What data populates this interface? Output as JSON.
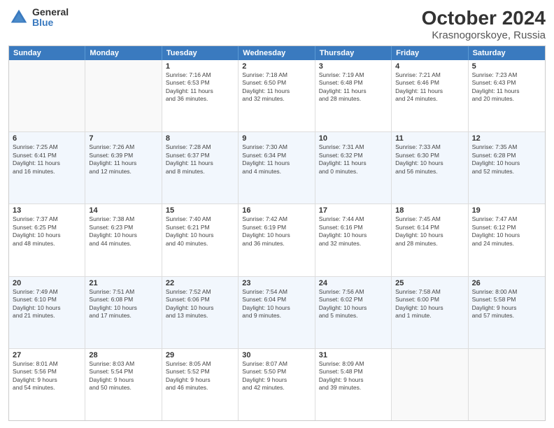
{
  "header": {
    "logo": {
      "general": "General",
      "blue": "Blue"
    },
    "title": "October 2024",
    "subtitle": "Krasnogorskoye, Russia"
  },
  "calendar": {
    "days": [
      "Sunday",
      "Monday",
      "Tuesday",
      "Wednesday",
      "Thursday",
      "Friday",
      "Saturday"
    ],
    "weeks": [
      [
        {
          "day": "",
          "info": ""
        },
        {
          "day": "",
          "info": ""
        },
        {
          "day": "1",
          "info": "Sunrise: 7:16 AM\nSunset: 6:53 PM\nDaylight: 11 hours\nand 36 minutes."
        },
        {
          "day": "2",
          "info": "Sunrise: 7:18 AM\nSunset: 6:50 PM\nDaylight: 11 hours\nand 32 minutes."
        },
        {
          "day": "3",
          "info": "Sunrise: 7:19 AM\nSunset: 6:48 PM\nDaylight: 11 hours\nand 28 minutes."
        },
        {
          "day": "4",
          "info": "Sunrise: 7:21 AM\nSunset: 6:46 PM\nDaylight: 11 hours\nand 24 minutes."
        },
        {
          "day": "5",
          "info": "Sunrise: 7:23 AM\nSunset: 6:43 PM\nDaylight: 11 hours\nand 20 minutes."
        }
      ],
      [
        {
          "day": "6",
          "info": "Sunrise: 7:25 AM\nSunset: 6:41 PM\nDaylight: 11 hours\nand 16 minutes."
        },
        {
          "day": "7",
          "info": "Sunrise: 7:26 AM\nSunset: 6:39 PM\nDaylight: 11 hours\nand 12 minutes."
        },
        {
          "day": "8",
          "info": "Sunrise: 7:28 AM\nSunset: 6:37 PM\nDaylight: 11 hours\nand 8 minutes."
        },
        {
          "day": "9",
          "info": "Sunrise: 7:30 AM\nSunset: 6:34 PM\nDaylight: 11 hours\nand 4 minutes."
        },
        {
          "day": "10",
          "info": "Sunrise: 7:31 AM\nSunset: 6:32 PM\nDaylight: 11 hours\nand 0 minutes."
        },
        {
          "day": "11",
          "info": "Sunrise: 7:33 AM\nSunset: 6:30 PM\nDaylight: 10 hours\nand 56 minutes."
        },
        {
          "day": "12",
          "info": "Sunrise: 7:35 AM\nSunset: 6:28 PM\nDaylight: 10 hours\nand 52 minutes."
        }
      ],
      [
        {
          "day": "13",
          "info": "Sunrise: 7:37 AM\nSunset: 6:25 PM\nDaylight: 10 hours\nand 48 minutes."
        },
        {
          "day": "14",
          "info": "Sunrise: 7:38 AM\nSunset: 6:23 PM\nDaylight: 10 hours\nand 44 minutes."
        },
        {
          "day": "15",
          "info": "Sunrise: 7:40 AM\nSunset: 6:21 PM\nDaylight: 10 hours\nand 40 minutes."
        },
        {
          "day": "16",
          "info": "Sunrise: 7:42 AM\nSunset: 6:19 PM\nDaylight: 10 hours\nand 36 minutes."
        },
        {
          "day": "17",
          "info": "Sunrise: 7:44 AM\nSunset: 6:16 PM\nDaylight: 10 hours\nand 32 minutes."
        },
        {
          "day": "18",
          "info": "Sunrise: 7:45 AM\nSunset: 6:14 PM\nDaylight: 10 hours\nand 28 minutes."
        },
        {
          "day": "19",
          "info": "Sunrise: 7:47 AM\nSunset: 6:12 PM\nDaylight: 10 hours\nand 24 minutes."
        }
      ],
      [
        {
          "day": "20",
          "info": "Sunrise: 7:49 AM\nSunset: 6:10 PM\nDaylight: 10 hours\nand 21 minutes."
        },
        {
          "day": "21",
          "info": "Sunrise: 7:51 AM\nSunset: 6:08 PM\nDaylight: 10 hours\nand 17 minutes."
        },
        {
          "day": "22",
          "info": "Sunrise: 7:52 AM\nSunset: 6:06 PM\nDaylight: 10 hours\nand 13 minutes."
        },
        {
          "day": "23",
          "info": "Sunrise: 7:54 AM\nSunset: 6:04 PM\nDaylight: 10 hours\nand 9 minutes."
        },
        {
          "day": "24",
          "info": "Sunrise: 7:56 AM\nSunset: 6:02 PM\nDaylight: 10 hours\nand 5 minutes."
        },
        {
          "day": "25",
          "info": "Sunrise: 7:58 AM\nSunset: 6:00 PM\nDaylight: 10 hours\nand 1 minute."
        },
        {
          "day": "26",
          "info": "Sunrise: 8:00 AM\nSunset: 5:58 PM\nDaylight: 9 hours\nand 57 minutes."
        }
      ],
      [
        {
          "day": "27",
          "info": "Sunrise: 8:01 AM\nSunset: 5:56 PM\nDaylight: 9 hours\nand 54 minutes."
        },
        {
          "day": "28",
          "info": "Sunrise: 8:03 AM\nSunset: 5:54 PM\nDaylight: 9 hours\nand 50 minutes."
        },
        {
          "day": "29",
          "info": "Sunrise: 8:05 AM\nSunset: 5:52 PM\nDaylight: 9 hours\nand 46 minutes."
        },
        {
          "day": "30",
          "info": "Sunrise: 8:07 AM\nSunset: 5:50 PM\nDaylight: 9 hours\nand 42 minutes."
        },
        {
          "day": "31",
          "info": "Sunrise: 8:09 AM\nSunset: 5:48 PM\nDaylight: 9 hours\nand 39 minutes."
        },
        {
          "day": "",
          "info": ""
        },
        {
          "day": "",
          "info": ""
        }
      ]
    ]
  }
}
